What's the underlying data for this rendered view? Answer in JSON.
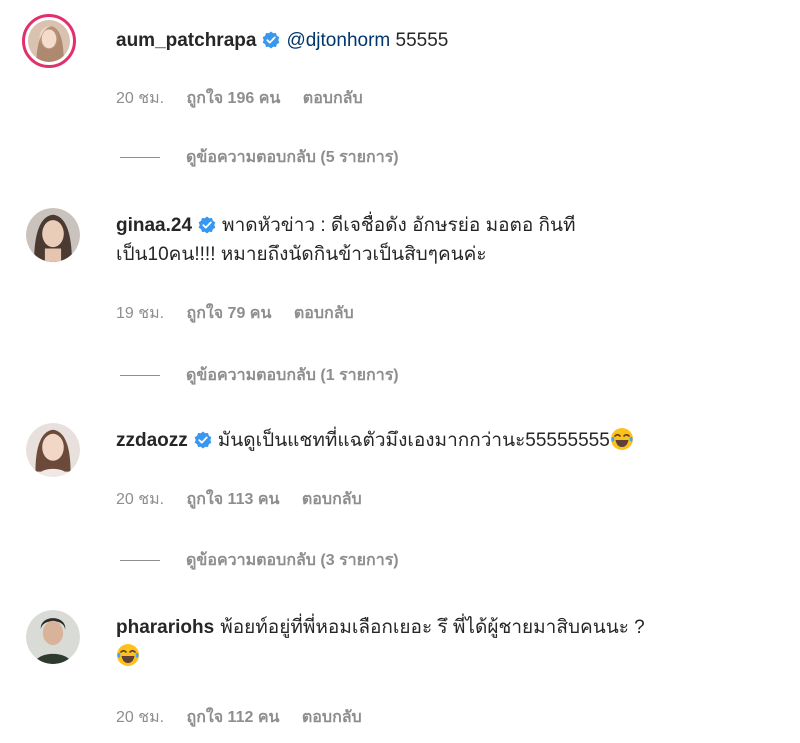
{
  "comments": [
    {
      "username": "aum_patchrapa",
      "verified": true,
      "mention": "@djtonhorm",
      "text": " 55555",
      "time": "20 ชม.",
      "likes": "ถูกใจ 196 คน",
      "reply": "ตอบกลับ",
      "view_replies": "ดูข้อความตอบกลับ (5 รายการ)"
    },
    {
      "username": "ginaa.24",
      "verified": true,
      "text_line1": "พาดหัวข่าว : ดีเจชื่อดัง อักษรย่อ มอตอ กินที",
      "text_line2": "เป็น10คน!!!! หมายถึงนัดกินข้าวเป็นสิบๆคนค่ะ",
      "time": "19 ชม.",
      "likes": "ถูกใจ 79 คน",
      "reply": "ตอบกลับ",
      "view_replies": "ดูข้อความตอบกลับ (1 รายการ)"
    },
    {
      "username": "zzdaozz",
      "verified": true,
      "text": "มันดูเป็นแชทที่แฉตัวมึงเองมากกว่านะ55555555",
      "emoji": "face-with-tears-of-joy",
      "time": "20 ชม.",
      "likes": "ถูกใจ 113 คน",
      "reply": "ตอบกลับ",
      "view_replies": "ดูข้อความตอบกลับ (3 รายการ)"
    },
    {
      "username": "pharariohs",
      "verified": false,
      "text_line1": "พ้อยท์อยู่ที่พี่หอมเลือกเยอะ รึ พี่ได้ผู้ชายมาสิบคนนะ ?",
      "emoji": "face-with-tears-of-joy",
      "time": "20 ชม.",
      "likes": "ถูกใจ 112 คน",
      "reply": "ตอบกลับ"
    }
  ],
  "colors": {
    "verified": "#3897f0",
    "mention": "#00376b",
    "meta": "#8e8e8e",
    "story_ring": "#e1306c"
  }
}
